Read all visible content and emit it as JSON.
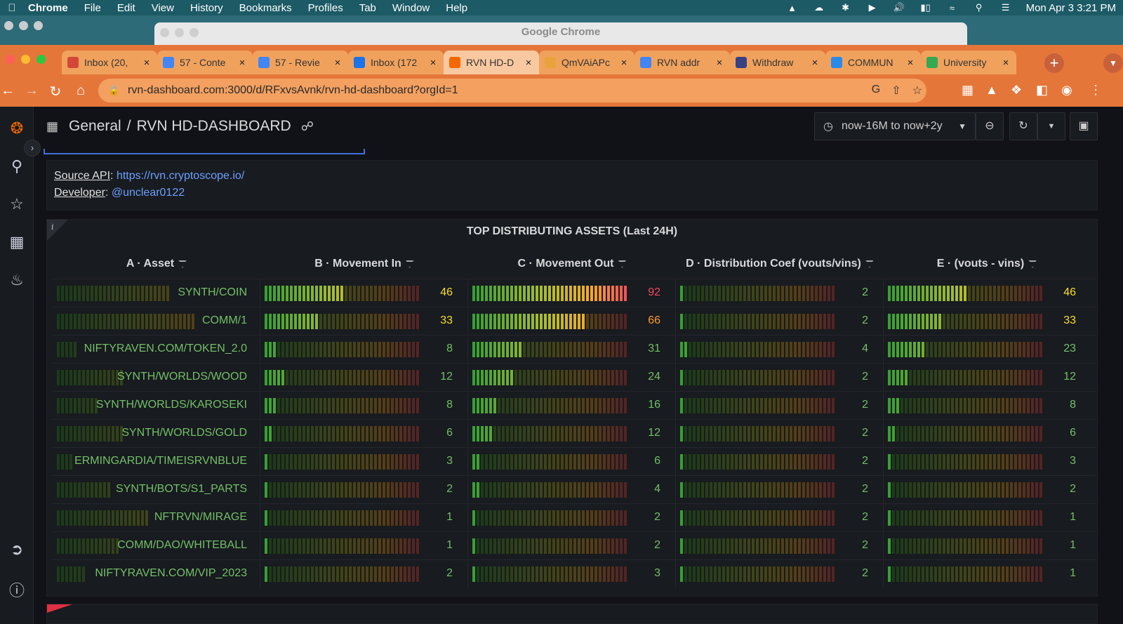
{
  "menubar": {
    "apple_icon": "apple-icon",
    "app": "Chrome",
    "items": [
      "File",
      "Edit",
      "View",
      "History",
      "Bookmarks",
      "Profiles",
      "Tab",
      "Window",
      "Help"
    ],
    "clock": "Mon Apr 3  3:21 PM"
  },
  "window": {
    "title": "Google Chrome"
  },
  "tabs": [
    {
      "label": "Inbox (20,",
      "icon": "gmail-icon",
      "color": "#d44638",
      "active": false
    },
    {
      "label": "57 - Conte",
      "icon": "docs-icon",
      "color": "#4285f4",
      "active": false
    },
    {
      "label": "57 - Revie",
      "icon": "docs-icon",
      "color": "#4285f4",
      "active": false
    },
    {
      "label": "Inbox (172",
      "icon": "mail-icon",
      "color": "#1a73e8",
      "active": false
    },
    {
      "label": "RVN HD-D",
      "icon": "grafana-icon",
      "color": "#f46800",
      "active": true
    },
    {
      "label": "QmVAiAPc",
      "icon": "ipfs-icon",
      "color": "#e8a33d",
      "active": false
    },
    {
      "label": "RVN addr",
      "icon": "docs-icon",
      "color": "#4285f4",
      "active": false
    },
    {
      "label": "Withdraw",
      "icon": "raven-icon",
      "color": "#384182",
      "active": false
    },
    {
      "label": "COMMUN",
      "icon": "commun-icon",
      "color": "#2b8ae6",
      "active": false
    },
    {
      "label": "University",
      "icon": "maps-icon",
      "color": "#34a853",
      "active": false
    }
  ],
  "address": {
    "url": "rvn-dashboard.com:3000/d/RFxvsAvnk/rvn-hd-dashboard?orgId=1"
  },
  "dashboard": {
    "folder": "General",
    "title": "RVN HD-DASHBOARD",
    "time_range": "now-16M to now+2y"
  },
  "text_panel": {
    "source_label": "Source API",
    "source_link": "https://rvn.cryptoscope.io/",
    "dev_label": "Developer",
    "dev_link": "@unclear0122"
  },
  "table_panel": {
    "title": "TOP DISTRIBUTING ASSETS (Last 24H)",
    "columns": [
      "A · Asset",
      "B · Movement In",
      "C · Movement Out",
      "D · Distribution Coef (vouts/vins)",
      "E · (vouts - vins)"
    ],
    "gauge_max": 92,
    "rows": [
      {
        "asset": "SYNTH/COIN",
        "in": 46,
        "out": 92,
        "coef": 2,
        "diff": 46
      },
      {
        "asset": "COMM/1",
        "in": 33,
        "out": 66,
        "coef": 2,
        "diff": 33
      },
      {
        "asset": "NIFTYRAVEN.COM/TOKEN_2.0",
        "in": 8,
        "out": 31,
        "coef": 4,
        "diff": 23
      },
      {
        "asset": "SYNTH/WORLDS/WOOD",
        "in": 12,
        "out": 24,
        "coef": 2,
        "diff": 12
      },
      {
        "asset": "SYNTH/WORLDS/KAROSEKI",
        "in": 8,
        "out": 16,
        "coef": 2,
        "diff": 8
      },
      {
        "asset": "SYNTH/WORLDS/GOLD",
        "in": 6,
        "out": 12,
        "coef": 2,
        "diff": 6
      },
      {
        "asset": "ERMINGARDIA/TIMEISRVNBLUE",
        "in": 3,
        "out": 6,
        "coef": 2,
        "diff": 3
      },
      {
        "asset": "SYNTH/BOTS/S1_PARTS",
        "in": 2,
        "out": 4,
        "coef": 2,
        "diff": 2
      },
      {
        "asset": "NFTRVN/MIRAGE",
        "in": 1,
        "out": 2,
        "coef": 2,
        "diff": 1
      },
      {
        "asset": "COMM/DAO/WHITEBALL",
        "in": 1,
        "out": 2,
        "coef": 2,
        "diff": 1
      },
      {
        "asset": "NIFTYRAVEN.COM/VIP_2023",
        "in": 2,
        "out": 3,
        "coef": 2,
        "diff": 1
      }
    ]
  },
  "colors": {
    "green": "#73bf69",
    "yellow": "#fade2a",
    "orange": "#ff9830",
    "red": "#f2495c",
    "link": "#6e9fff",
    "tab_strip": "#e5763a"
  }
}
